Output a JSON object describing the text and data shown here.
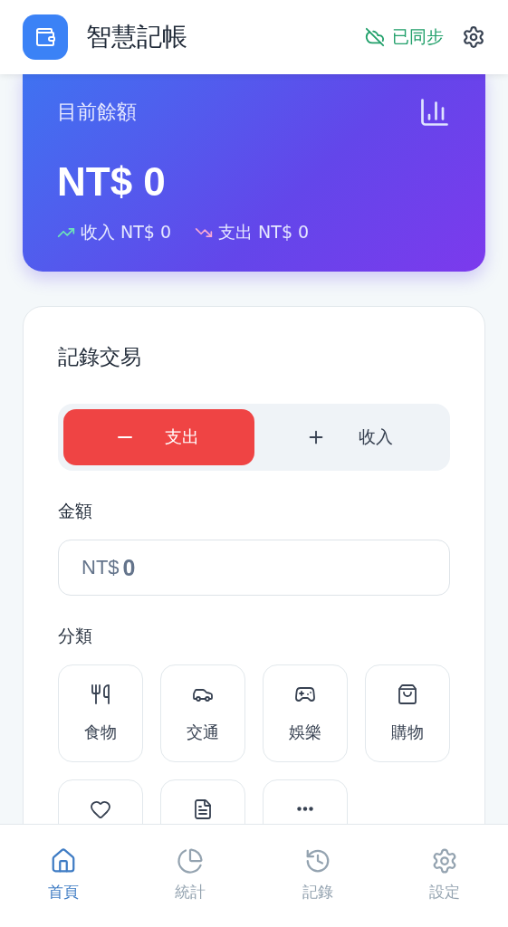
{
  "header": {
    "title": "智慧記帳",
    "sync_status": "已同步"
  },
  "balance": {
    "label": "目前餘額",
    "amount": "NT$ 0",
    "income": "收入 NT$ 0",
    "expense": "支出 NT$ 0"
  },
  "form": {
    "title": "記錄交易",
    "type_tabs": [
      {
        "kind": "minus",
        "label": "支出",
        "selected": true
      },
      {
        "kind": "plus",
        "label": "收入",
        "selected": false
      }
    ],
    "amount_label": "金額",
    "amount": {
      "prefix": "NT$",
      "value": "0"
    },
    "category_label": "分類",
    "categories": [
      {
        "kind": "food",
        "label": "食物"
      },
      {
        "kind": "transport",
        "label": "交通"
      },
      {
        "kind": "entertainment",
        "label": "娛樂"
      },
      {
        "kind": "shopping",
        "label": "購物"
      },
      {
        "kind": "health"
      },
      {
        "kind": "bill"
      },
      {
        "kind": "other"
      }
    ]
  },
  "bottom_nav": [
    {
      "kind": "home",
      "label": "首頁",
      "selected": true
    },
    {
      "kind": "stats",
      "label": "統計",
      "selected": false
    },
    {
      "kind": "records",
      "label": "記錄",
      "selected": false
    },
    {
      "kind": "settings",
      "label": "設定",
      "selected": false
    }
  ]
}
